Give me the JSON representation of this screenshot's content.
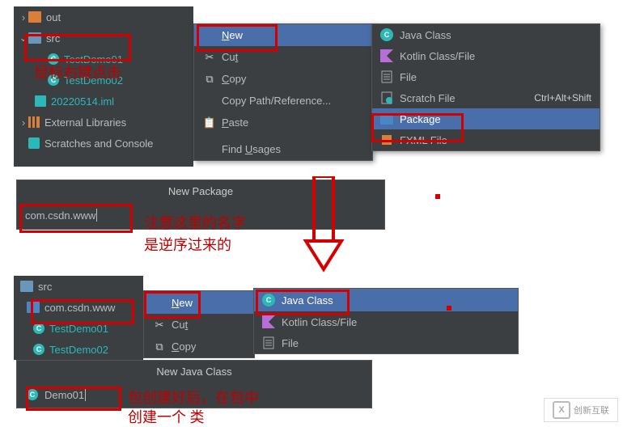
{
  "tree1": {
    "out": "out",
    "src": "src",
    "testdemo01": "TestDemo01",
    "testdemo02": "TestDemo02",
    "iml": "20220514.iml",
    "ext": "External Libraries",
    "scratch": "Scratches and Console"
  },
  "ctx1": {
    "new": "New",
    "cut": "Cut",
    "copy": "Copy",
    "copypath": "Copy Path/Reference...",
    "paste": "Paste",
    "findusages": "Find Usages"
  },
  "sub1": {
    "javaclass": "Java Class",
    "kotlin": "Kotlin Class/File",
    "file": "File",
    "scratch": "Scratch File",
    "scratch_kb": "Ctrl+Alt+Shift",
    "package": "Package",
    "fxml": "FXML File"
  },
  "newpkg": {
    "title": "New Package",
    "value": "com.csdn.www"
  },
  "tree2": {
    "src": "src",
    "pkg": "com.csdn.www",
    "td1": "TestDemo01",
    "td2": "TestDemo02"
  },
  "ctx2": {
    "new": "New",
    "cut": "Cut",
    "copy": "Copy"
  },
  "sub2": {
    "javaclass": "Java Class",
    "kotlin": "Kotlin Class/File",
    "file": "File"
  },
  "newcls": {
    "title": "New Java Class",
    "value": "Demo01"
  },
  "ann": {
    "rightclick": "鼠标右键点击",
    "note1": "注意这里的名字",
    "note2": "是逆序过来的",
    "after1": "包创建好后，在包中",
    "after2": "创建一个 类"
  },
  "watermark": "创新互联"
}
